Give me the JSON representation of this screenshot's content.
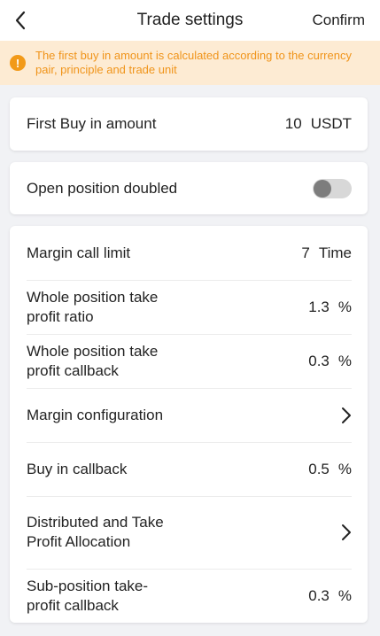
{
  "header": {
    "title": "Trade settings",
    "confirm_label": "Confirm",
    "back_icon": "chevron-left-icon"
  },
  "notice": {
    "icon": "warning-icon",
    "icon_glyph": "!",
    "text": "The first buy in amount is calculated according to the currency pair, principle and trade unit",
    "color": "#f0941a",
    "background": "#fdebd3"
  },
  "first_buy": {
    "label": "First Buy in amount",
    "value": "10",
    "unit": "USDT"
  },
  "open_position_doubled": {
    "label": "Open position doubled",
    "enabled": false
  },
  "settings": {
    "margin_call_limit": {
      "label": "Margin call limit",
      "value": "7",
      "unit": "Time"
    },
    "whole_tp_ratio": {
      "label": "Whole position take profit ratio",
      "value": "1.3",
      "unit": "%"
    },
    "whole_tp_callback": {
      "label": "Whole position take profit callback",
      "value": "0.3",
      "unit": "%"
    },
    "margin_configuration": {
      "label": "Margin configuration"
    },
    "buy_in_callback": {
      "label": "Buy in callback",
      "value": "0.5",
      "unit": "%"
    },
    "distributed_tp_allocation": {
      "label": "Distributed and Take Profit Allocation"
    },
    "sub_position_tp_callback": {
      "label": "Sub-position take-profit callback",
      "value": "0.3",
      "unit": "%"
    }
  }
}
